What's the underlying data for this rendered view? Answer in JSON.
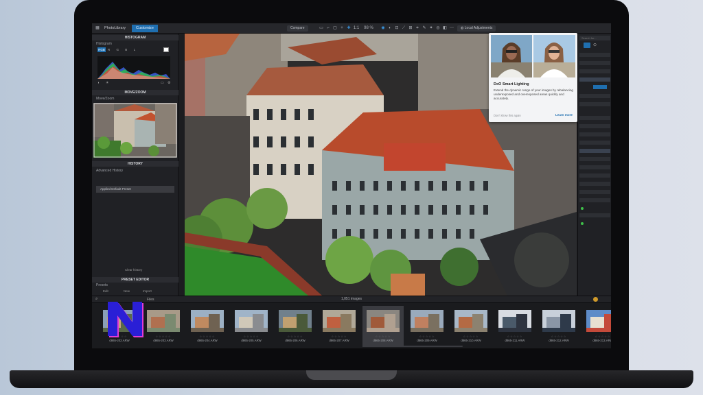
{
  "app": {
    "tabs": [
      "PhotoLibrary",
      "Customize"
    ],
    "compare_label": "Compare",
    "zoom_value": "1:1",
    "zoom_percent": "98 %",
    "local_adjustments_label": "Local Adjustments"
  },
  "left_panel": {
    "histogram_header": "HISTOGRAM",
    "histogram_sub": "Histogram",
    "histogram_mode": "RGB",
    "histogram_channels": [
      "R",
      "G",
      "B",
      "L"
    ],
    "movezoom_header": "MOVE/ZOOM",
    "movezoom_sub": "Move/Zoom",
    "history_header": "HISTORY",
    "history_sub": "Advanced History",
    "history_item": "Applied Default Preset",
    "history_footer": "Clear history",
    "preset_header": "PRESET EDITOR",
    "preset_sub": "Presets",
    "preset_buttons": [
      "Edit",
      "New",
      "Import"
    ]
  },
  "popup": {
    "title": "DxO Smart Lighting",
    "body": "Extend the dynamic range of your images by rebalancing underexposed and overexposed areas quickly and accurately.",
    "dont_show": "Don't show this again",
    "learn_more": "Learn more"
  },
  "right_panel": {
    "search_placeholder": "Search for..."
  },
  "filmstrip": {
    "count_label": "1,051 images",
    "files_label": "Files",
    "thumbs": [
      {
        "name": "d865-202.ARW"
      },
      {
        "name": "d865-203.ARW"
      },
      {
        "name": "d865-204.ARW"
      },
      {
        "name": "d865-205.ARW"
      },
      {
        "name": "d865-206.ARW"
      },
      {
        "name": "d865-207.ARW"
      },
      {
        "name": "d865-208.ARW"
      },
      {
        "name": "d865-209.ARW"
      },
      {
        "name": "d865-210.ARW"
      },
      {
        "name": "d865-211.ARW"
      },
      {
        "name": "d865-212.ARW"
      },
      {
        "name": "d865-213.ARW"
      }
    ],
    "stars": "☆☆☆☆☆"
  },
  "colors": {
    "accent": "#1f6fb0",
    "logo_fill": "#2a1fd6",
    "logo_outline": "#e23bd6"
  }
}
